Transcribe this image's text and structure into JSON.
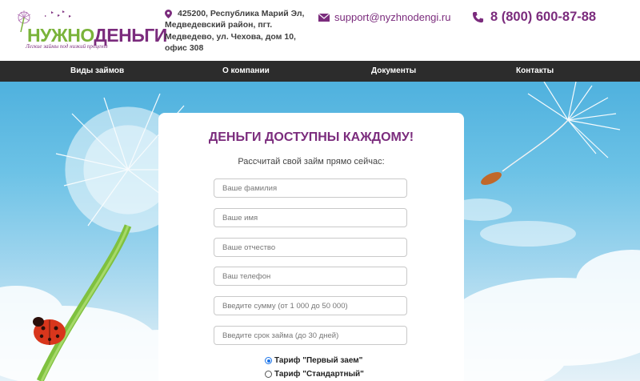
{
  "header": {
    "logo": {
      "word1": "НУЖНО",
      "word2": "ДЕНЬГИ",
      "tagline": "Легкие займы под низкий процент"
    },
    "address_lines": [
      "425200, Республика Марий Эл,",
      "Медведевский район, пгт.",
      "Медведево, ул. Чехова, дом 10,",
      "офис 308"
    ],
    "email": "support@nyzhnodengi.ru",
    "phone": "8 (800) 600-87-88"
  },
  "nav": {
    "items": [
      {
        "label": "Виды займов"
      },
      {
        "label": "О компании"
      },
      {
        "label": "Документы"
      },
      {
        "label": "Контакты"
      }
    ]
  },
  "form": {
    "title": "ДЕНЬГИ ДОСТУПНЫ КАЖДОМУ!",
    "subtitle": "Рассчитай свой займ прямо сейчас:",
    "fields": [
      {
        "placeholder": "Ваше фамилия",
        "value": ""
      },
      {
        "placeholder": "Ваше имя",
        "value": ""
      },
      {
        "placeholder": "Ваше отчество",
        "value": ""
      },
      {
        "placeholder": "Ваш телефон",
        "value": ""
      },
      {
        "placeholder": "Введите сумму (от 1 000 до 50 000)",
        "value": ""
      },
      {
        "placeholder": "Введите срок займа (до 30 дней)",
        "value": ""
      }
    ],
    "tariffs": [
      {
        "label": "Тариф \"Первый заем\"",
        "selected": true
      },
      {
        "label": "Тариф \"Стандартный\"",
        "selected": false
      }
    ]
  },
  "colors": {
    "brand_purple": "#7b2c7d",
    "brand_green": "#7ab33a",
    "nav_bg": "#2c2c2c"
  }
}
